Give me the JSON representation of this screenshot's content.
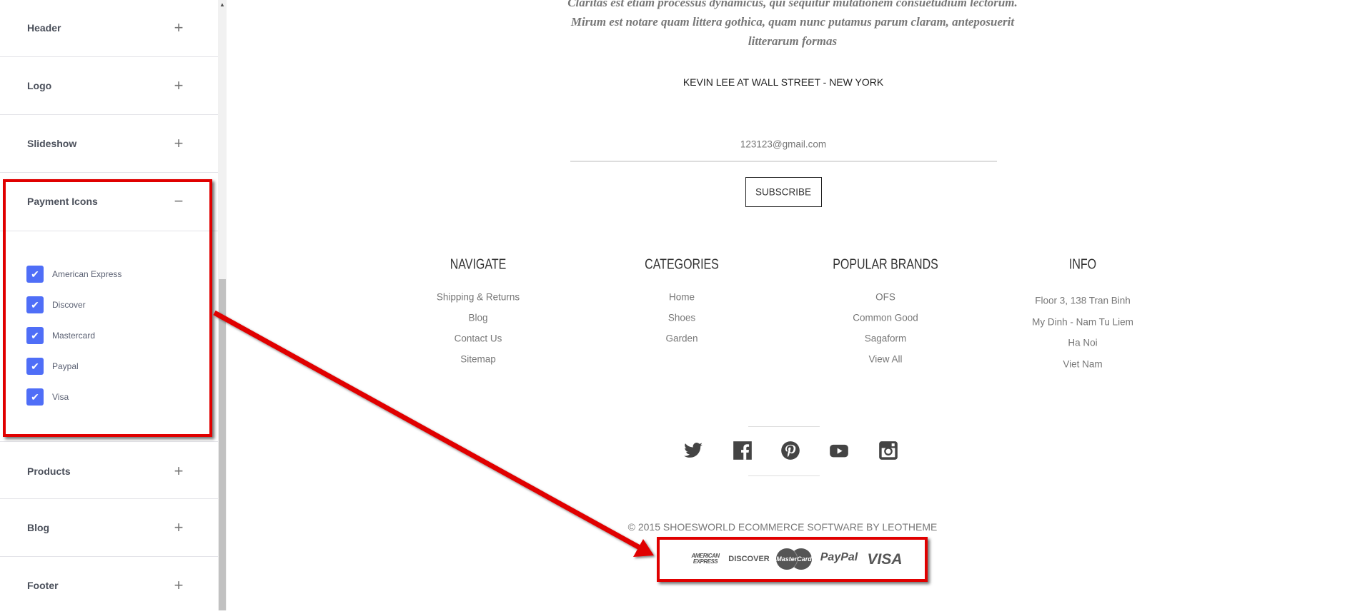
{
  "sidebar": {
    "sections": [
      {
        "label": "Header",
        "toggle": "+"
      },
      {
        "label": "Logo",
        "toggle": "+"
      },
      {
        "label": "Slideshow",
        "toggle": "+"
      },
      {
        "label": "Payment Icons",
        "toggle": "−",
        "expanded": true
      },
      {
        "label": "Products",
        "toggle": "+"
      },
      {
        "label": "Blog",
        "toggle": "+"
      },
      {
        "label": "Footer",
        "toggle": "+"
      }
    ],
    "payment_options": [
      {
        "label": "American Express",
        "checked": true
      },
      {
        "label": "Discover",
        "checked": true
      },
      {
        "label": "Mastercard",
        "checked": true
      },
      {
        "label": "Paypal",
        "checked": true
      },
      {
        "label": "Visa",
        "checked": true
      }
    ],
    "checkbox_color": "#4f6ef7"
  },
  "main": {
    "quote_lines": [
      "Claritas est etiam processus dynamicus, qui sequitur mutationem consuetudium lectorum.",
      "Mirum est notare quam littera gothica, quam nunc putamus parum claram, anteposuerit",
      "litterarum formas"
    ],
    "quote_author": "KEVIN LEE AT WALL STREET - NEW YORK",
    "newsletter": {
      "email_value": "123123@gmail.com",
      "subscribe_label": "SUBSCRIBE"
    },
    "columns": [
      {
        "title": "NAVIGATE",
        "links": [
          "Shipping & Returns",
          "Blog",
          "Contact Us",
          "Sitemap"
        ]
      },
      {
        "title": "CATEGORIES",
        "links": [
          "Home",
          "Shoes",
          "Garden"
        ]
      },
      {
        "title": "POPULAR BRANDS",
        "links": [
          "OFS",
          "Common Good",
          "Sagaform",
          "View All"
        ]
      },
      {
        "title": "INFO",
        "links": [
          "Floor 3, 138 Tran Binh",
          "My Dinh - Nam Tu Liem",
          "Ha Noi",
          "Viet Nam"
        ]
      }
    ],
    "social_icons": [
      "twitter-icon",
      "facebook-icon",
      "pinterest-icon",
      "youtube-icon",
      "instagram-icon"
    ],
    "copyright": "© 2015 SHOESWORLD ECOMMERCE SOFTWARE BY LEOTHEME",
    "payment_icons": {
      "amex_line1": "AMERICAN",
      "amex_line2": "EXPRESS",
      "discover": "DISCOVER",
      "mastercard": "MasterCard",
      "paypal": "PayPal",
      "visa": "VISA"
    }
  },
  "annotation_color": "#e00000"
}
